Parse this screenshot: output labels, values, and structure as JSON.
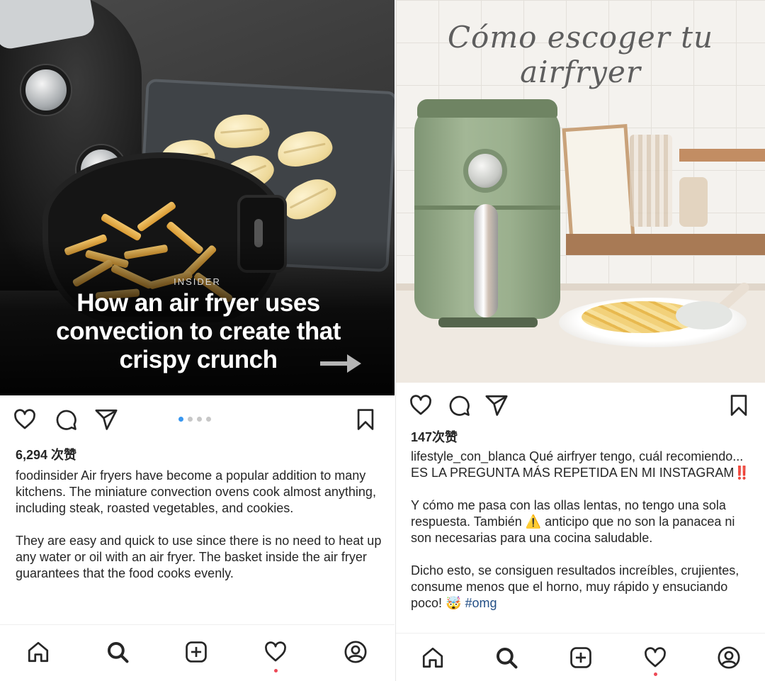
{
  "postA": {
    "image": {
      "brand": "INSIDER",
      "headline": "How an air fryer uses convection to create that crispy crunch"
    },
    "carousel": {
      "count": 4,
      "active": 0
    },
    "likes": "6,294 次赞",
    "username": "foodinsider",
    "caption_first": " Air fryers have become a popular addition to many kitchens.  The miniature convection ovens cook almost anything, including steak, roasted vegetables, and cookies.",
    "caption_second": "They are easy and quick to use since there is no need to heat up any water or oil with an air fryer.  The basket inside the air fryer guarantees that the food cooks evenly.",
    "nav_notification": true
  },
  "postB": {
    "image": {
      "title": "Cómo escoger tu airfryer"
    },
    "likes": "147次赞",
    "username": "lifestyle_con_blanca",
    "caption_first": " Qué airfryer tengo, cuál recomiendo... ES LA PREGUNTA MÁS REPETIDA EN MI INSTAGRAM‼️",
    "caption_second": "Y cómo me pasa con las ollas lentas, no tengo una sola respuesta. También ⚠️ anticipo que no son la panacea ni son necesarias para una cocina saludable.",
    "caption_third_text": "Dicho esto, se consiguen resultados increíbles, crujientes, consume menos que el horno, muy rápido y ensuciando poco! 🤯 ",
    "hashtag": "#omg",
    "nav_notification": true
  },
  "icons": {
    "like": "heart-icon",
    "comment": "comment-icon",
    "share": "paper-plane-icon",
    "save": "bookmark-icon",
    "nav": [
      "home-icon",
      "search-icon",
      "add-post-icon",
      "activity-heart-icon",
      "profile-icon"
    ]
  },
  "colors": {
    "text": "#262626",
    "carousel_active": "#3897f0",
    "hashtag": "#234f86",
    "notification": "#ed4956"
  }
}
